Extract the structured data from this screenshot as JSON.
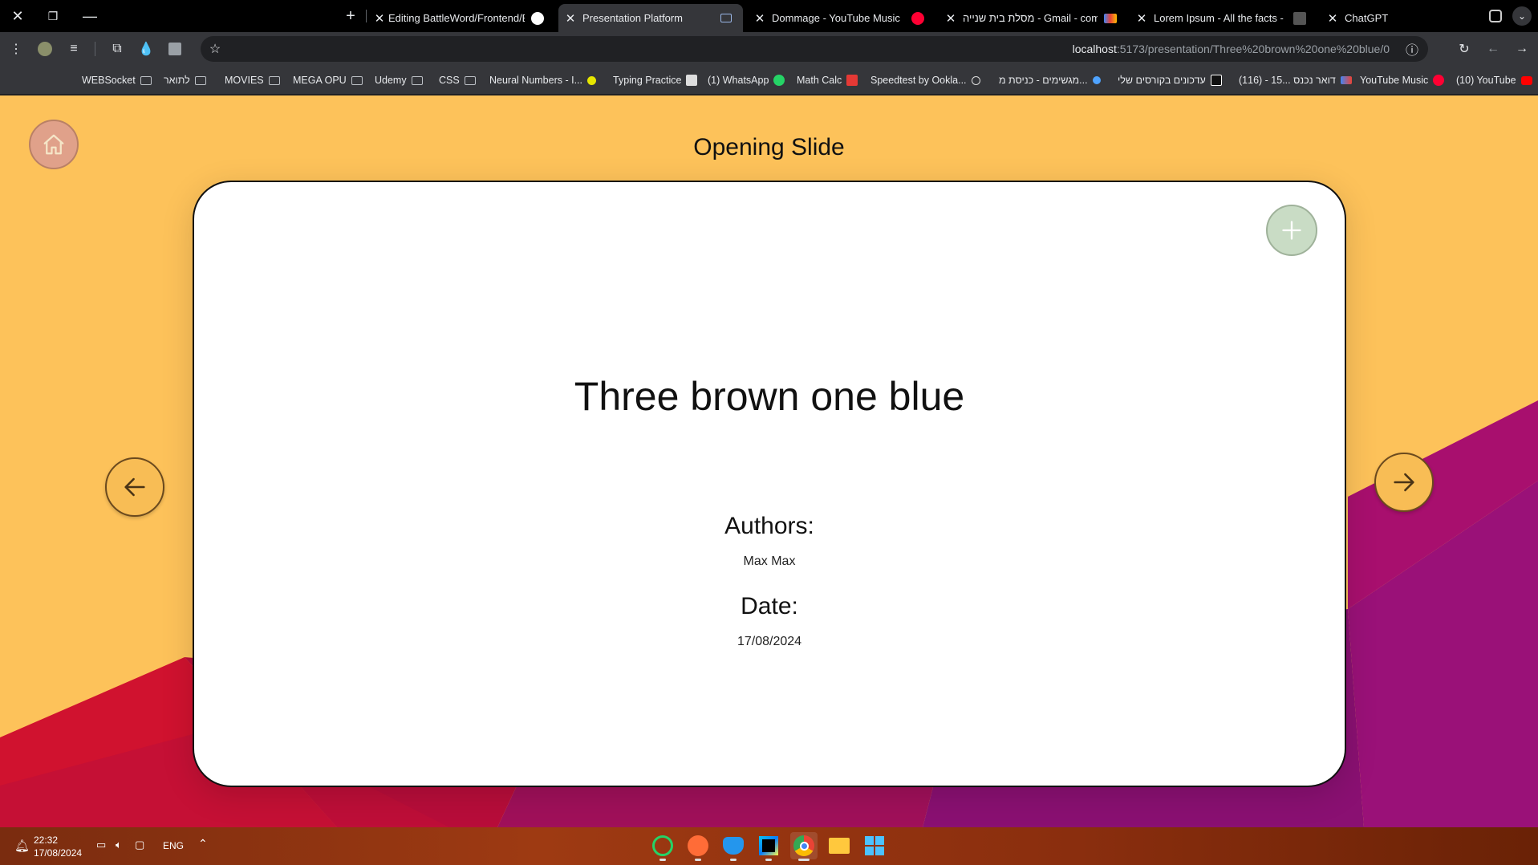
{
  "browser": {
    "tabs": [
      {
        "title": "",
        "icon": "new-tab"
      },
      {
        "title": "Editing BattleWord/Frontend/B",
        "icon": "github-icon"
      },
      {
        "title": "Presentation Platform",
        "icon": "cast-icon",
        "active": true
      },
      {
        "title": "Dommage - YouTube Music",
        "icon": "youtube-music-icon"
      },
      {
        "title": "מסלת בית שנייה - Gmail - com.",
        "icon": "gmail-icon"
      },
      {
        "title": "Lorem Ipsum - All the facts - Lip",
        "icon": "lipsum-icon"
      },
      {
        "title": "ChatGPT",
        "icon": "chatgpt-icon"
      }
    ],
    "url_host": "localhost",
    "url_rest": ":5173/presentation/Three%20brown%20one%20blue/0",
    "bookmarks": [
      "WEBSocket",
      "לתואר",
      "MOVIES",
      "MEGA OPU",
      "Udemy",
      "CSS",
      "Neural Numbers - I...",
      "Typing Practice",
      "(1) WhatsApp",
      "Math Calc",
      "Speedtest by Ookla...",
      "מגשימים - כניסת מ...",
      "עדכונים בקורסים שלי",
      "(116) - 15... דואר נכנס",
      "YouTube Music",
      "(10) YouTube"
    ]
  },
  "page": {
    "slide_title": "Opening Slide",
    "presentation_title": "Three brown one blue",
    "authors_label": "Authors:",
    "authors_value": "Max Max",
    "date_label": "Date:",
    "date_value": "17/08/2024"
  },
  "colors": {
    "background": "#fdc25a",
    "home_button": "#e0a18a",
    "add_button": "#c9dcc5",
    "card": "#ffffff"
  },
  "taskbar": {
    "time": "22:32",
    "date": "17/08/2024",
    "language": "ENG"
  }
}
